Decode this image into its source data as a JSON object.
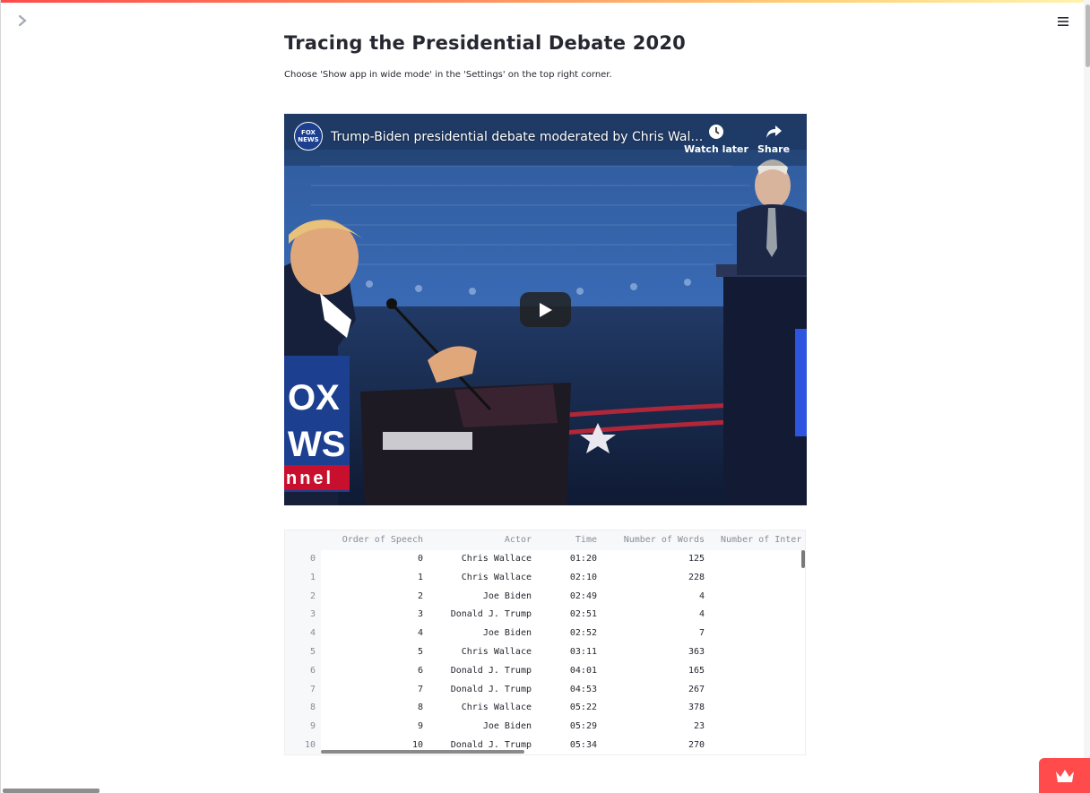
{
  "page": {
    "title": "Tracing the Presidential Debate 2020",
    "subtitle": "Choose 'Show app in wide mode' in the 'Settings' on the top right corner."
  },
  "video": {
    "title": "Trump-Biden presidential debate moderated by Chris Wal…",
    "channel_logo_text": "FOX NEWS",
    "watch_later_label": "Watch later",
    "share_label": "Share",
    "watermark_lines": [
      "OX",
      "WS",
      "nnel"
    ]
  },
  "table": {
    "columns": [
      "Order of Speech",
      "Actor",
      "Time",
      "Number of Words",
      "Number of Inter"
    ],
    "rows": [
      {
        "index": "0",
        "order": "0",
        "actor": "Chris Wallace",
        "time": "01:20",
        "words": "125"
      },
      {
        "index": "1",
        "order": "1",
        "actor": "Chris Wallace",
        "time": "02:10",
        "words": "228"
      },
      {
        "index": "2",
        "order": "2",
        "actor": "Joe Biden",
        "time": "02:49",
        "words": "4"
      },
      {
        "index": "3",
        "order": "3",
        "actor": "Donald J. Trump",
        "time": "02:51",
        "words": "4"
      },
      {
        "index": "4",
        "order": "4",
        "actor": "Joe Biden",
        "time": "02:52",
        "words": "7"
      },
      {
        "index": "5",
        "order": "5",
        "actor": "Chris Wallace",
        "time": "03:11",
        "words": "363"
      },
      {
        "index": "6",
        "order": "6",
        "actor": "Donald J. Trump",
        "time": "04:01",
        "words": "165"
      },
      {
        "index": "7",
        "order": "7",
        "actor": "Donald J. Trump",
        "time": "04:53",
        "words": "267"
      },
      {
        "index": "8",
        "order": "8",
        "actor": "Chris Wallace",
        "time": "05:22",
        "words": "378"
      },
      {
        "index": "9",
        "order": "9",
        "actor": "Joe Biden",
        "time": "05:29",
        "words": "23"
      },
      {
        "index": "10",
        "order": "10",
        "actor": "Donald J. Trump",
        "time": "05:34",
        "words": "270"
      }
    ]
  },
  "icons": {
    "sidebar_toggle": "chevron-right-icon",
    "menu": "hamburger-menu-icon",
    "watch_later": "clock-icon",
    "share": "share-arrow-icon",
    "play": "play-icon",
    "badge": "crown-icon"
  },
  "colors": {
    "accent": "#ff4b4b",
    "text": "#262730",
    "muted": "#888c99"
  }
}
